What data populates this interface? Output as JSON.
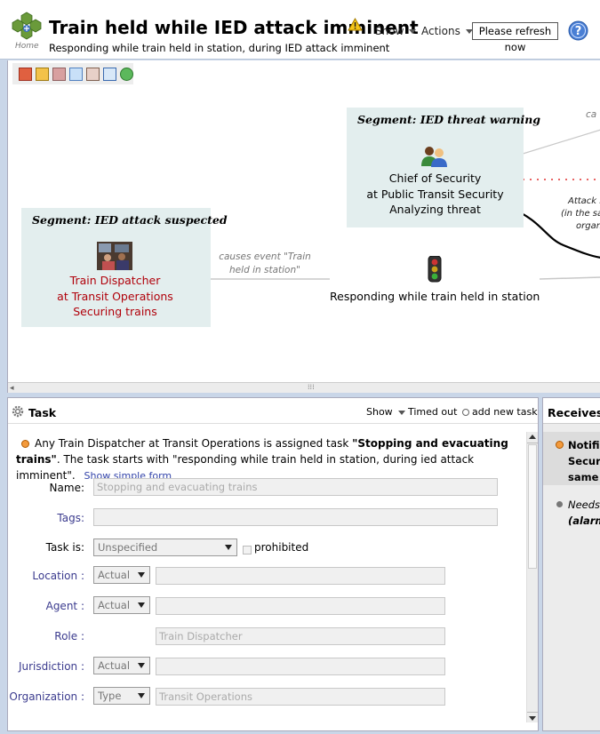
{
  "header": {
    "home_label": "Home",
    "title": "Train held while IED attack imminent",
    "subtitle": "Responding while train held in station, during IED attack imminent",
    "show_menu": "Show",
    "actions_menu": "Actions",
    "refresh_button": "Please refresh now"
  },
  "diagram": {
    "segments": [
      {
        "title": "Segment: IED threat warning",
        "node_lines": [
          "Chief of Security",
          "at Public Transit Security",
          "Analyzing threat"
        ],
        "icon": "users-icon"
      },
      {
        "title": "Segment: IED attack suspected",
        "node_lines": [
          "Train Dispatcher",
          "at Transit Operations",
          "Securing trains"
        ],
        "icon": "dispatcher-photo"
      }
    ],
    "center_node": {
      "label": "Responding while train held in station",
      "icon": "traffic-light-icon"
    },
    "edge_labels": {
      "causes_train_held": [
        "causes event \"Train",
        "held in station\""
      ],
      "top_right_cut": "ca",
      "attack_lines": [
        "Attack i",
        "(in the sa",
        "organ"
      ]
    },
    "scroll_grip": "⁞⁞⁞"
  },
  "task_panel": {
    "title": "Task",
    "show_menu": "Show",
    "timed_out": "Timed out",
    "add_new_task": "add new task",
    "description_prefix": "Any Train Dispatcher at Transit Operations is assigned task ",
    "description_task": "\"Stopping and evacuating trains\"",
    "description_suffix": ". The task starts with \"responding while train held in station, during ied attack imminent\".",
    "show_simple_form": "Show simple form",
    "fields": {
      "name_label": "Name:",
      "name_value": "Stopping and evacuating trains",
      "tags_label": "Tags:",
      "tags_value": "",
      "task_is_label": "Task is:",
      "task_is_value": "Unspecified",
      "prohibited_label": "prohibited",
      "location_label": "Location :",
      "location_mode": "Actual",
      "location_value": "",
      "agent_label": "Agent :",
      "agent_mode": "Actual",
      "agent_value": "",
      "role_label": "Role :",
      "role_value": "Train Dispatcher",
      "jurisdiction_label": "Jurisdiction :",
      "jurisdiction_mode": "Actual",
      "jurisdiction_value": "",
      "organization_label": "Organization :",
      "organization_mode": "Type",
      "organization_value": "Transit Operations"
    }
  },
  "receives_panel": {
    "title": "Receives",
    "item1_lines": [
      "Notifie",
      "Securi",
      "same d"
    ],
    "item2_lines": [
      "Needs",
      "(alarm"
    ]
  },
  "colors": {
    "segment_bg": "#e3eeee",
    "red_text": "#b0000a",
    "link": "#3344aa"
  }
}
